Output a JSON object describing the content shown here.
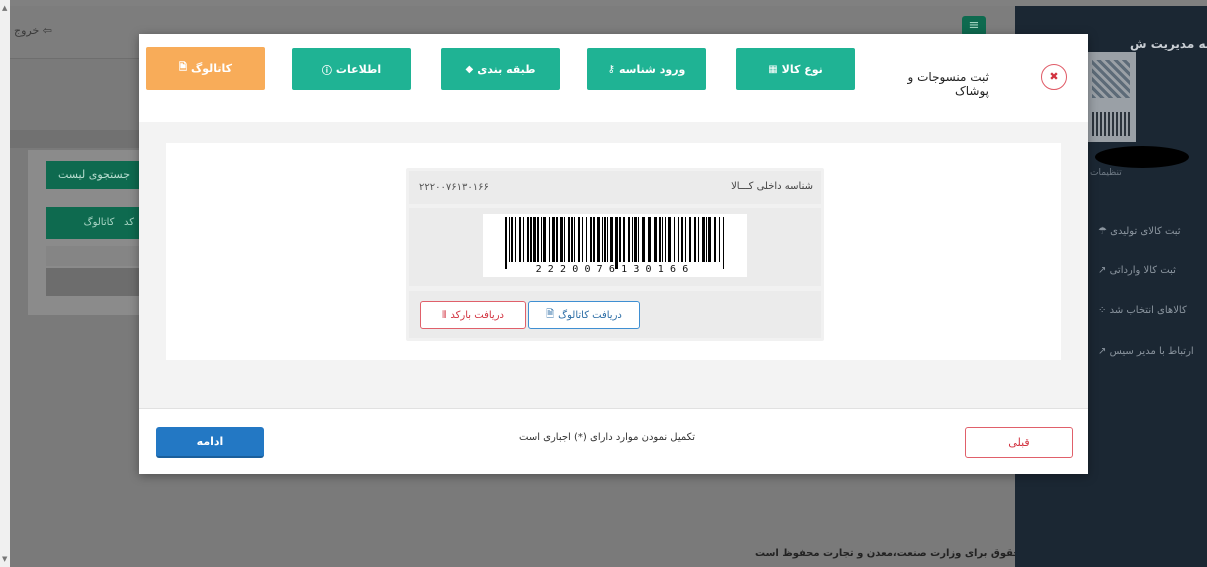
{
  "background": {
    "logout_label": "خروج",
    "menu_icon": "≡",
    "search_list_button": "جستجوی لیست",
    "table_col_catalog": "کاتالوگ",
    "table_col_code": "کد",
    "footer_text": "کلیه حقوق برای وزارت صنعت،معدن و تجارت محفوظ است",
    "sidebar": {
      "title": "سامانه مدیریت ش",
      "settings": "تنظیمات",
      "items": [
        "ثبت کالای تولیدی",
        "ثبت کالا وارداتی",
        "کالاهای انتخاب شد",
        "ارتباط با مدیر سیس"
      ]
    }
  },
  "modal": {
    "title": "ثبت منسوجات و پوشاک",
    "steps": [
      {
        "label": "نوع کالا",
        "icon": "grid-icon"
      },
      {
        "label": "ورود شناسه",
        "icon": "key-icon"
      },
      {
        "label": "طبقه بندی",
        "icon": "tag-icon"
      },
      {
        "label": "اطلاعات",
        "icon": "info-icon"
      },
      {
        "label": "کاتالوگ",
        "icon": "document-icon",
        "active": true
      }
    ],
    "barcode_section": {
      "internal_id_label": "شناسه داخلی کـــالا",
      "internal_id_value": "۲۲۲۰۰۷۶۱۳۰۱۶۶",
      "barcode_digits": "2220076130166",
      "download_catalog_label": "دریافت کاتالوگ",
      "download_barcode_label": "دریافت بارکد"
    },
    "footer": {
      "continue_label": "ادامه",
      "required_note": "تکمیل نمودن موارد دارای (*) اجباری است",
      "previous_label": "قبلی"
    },
    "colors": {
      "step_green": "#1fb394",
      "step_active": "#f8ac59",
      "primary_blue": "#2378c4",
      "danger_red": "#d2323f"
    }
  }
}
